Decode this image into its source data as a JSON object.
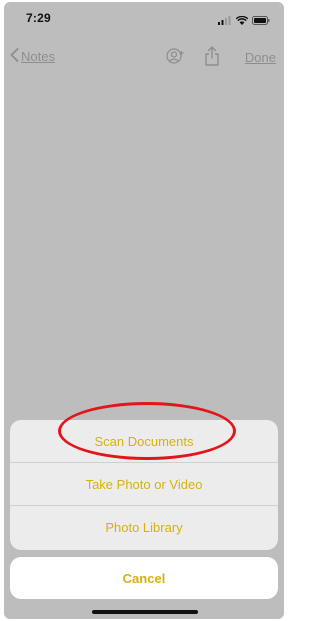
{
  "status_bar": {
    "time": "7:29",
    "icons": [
      "signal-icon",
      "wifi-icon",
      "battery-icon"
    ]
  },
  "nav_bar": {
    "back_label": "Notes",
    "icons": [
      "add-person-icon",
      "share-icon"
    ],
    "done_label": "Done"
  },
  "action_sheet": {
    "items": [
      {
        "label": "Scan Documents"
      },
      {
        "label": "Take Photo or Video"
      },
      {
        "label": "Photo Library"
      }
    ],
    "cancel_label": "Cancel"
  },
  "colors": {
    "accent": "#d6b10e",
    "highlight": "#e2161a",
    "dimmed_background": "#bdbdbd"
  }
}
